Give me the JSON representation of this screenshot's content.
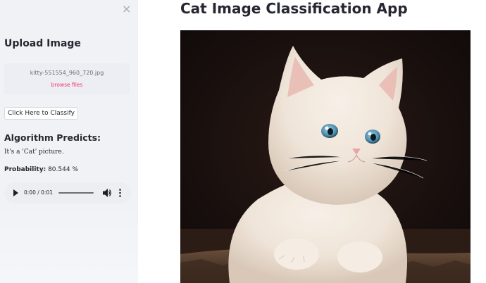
{
  "sidebar": {
    "close_glyph": "×",
    "upload_heading": "Upload Image",
    "uploader": {
      "filename": "kitty-551554_960_720.jpg",
      "browse_label": "browse files"
    },
    "classify_button": "Click Here to Classify",
    "algorithm_heading": "Algorithm Predicts:",
    "prediction_text": "It's a 'Cat' picture.",
    "probability_label": "Probability:",
    "probability_value": "80.544 %",
    "audio": {
      "time": "0:00 / 0:01",
      "progress": 0
    }
  },
  "main": {
    "title": "Cat Image Classification App",
    "image_subject": "white kitten photo"
  },
  "colors": {
    "sidebar_bg": "#f0f2f6",
    "accent_link": "#f63366",
    "text": "#262730"
  }
}
